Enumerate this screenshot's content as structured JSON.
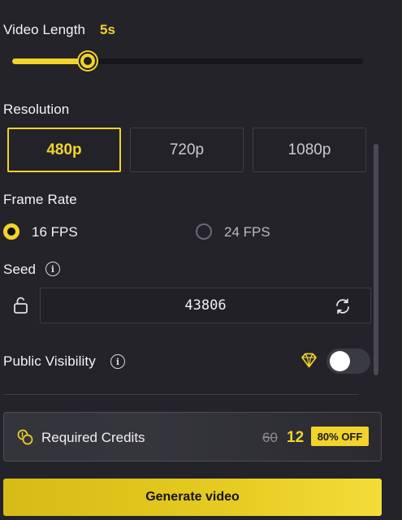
{
  "video_length": {
    "label": "Video Length",
    "value": "5s",
    "slider_fraction": 0.215
  },
  "resolution": {
    "label": "Resolution",
    "options": [
      "480p",
      "720p",
      "1080p"
    ],
    "selected": "480p"
  },
  "frame_rate": {
    "label": "Frame Rate",
    "options": [
      "16 FPS",
      "24 FPS"
    ],
    "selected": "16 FPS"
  },
  "seed": {
    "label": "Seed",
    "value": "43806"
  },
  "visibility": {
    "label": "Public Visibility",
    "enabled": false
  },
  "credits": {
    "label": "Required Credits",
    "old_price": "60",
    "new_price": "12",
    "badge": "80% OFF"
  },
  "generate_button": {
    "label": "Generate video"
  },
  "colors": {
    "accent": "#f1d32b",
    "background": "#232329",
    "border": "#3e3e46"
  },
  "icons": {
    "seed_info": "info-icon",
    "lock": "unlock-icon",
    "refresh": "refresh-icon",
    "visibility_info": "info-icon",
    "premium": "diamond-icon",
    "credits": "coins-icon"
  }
}
